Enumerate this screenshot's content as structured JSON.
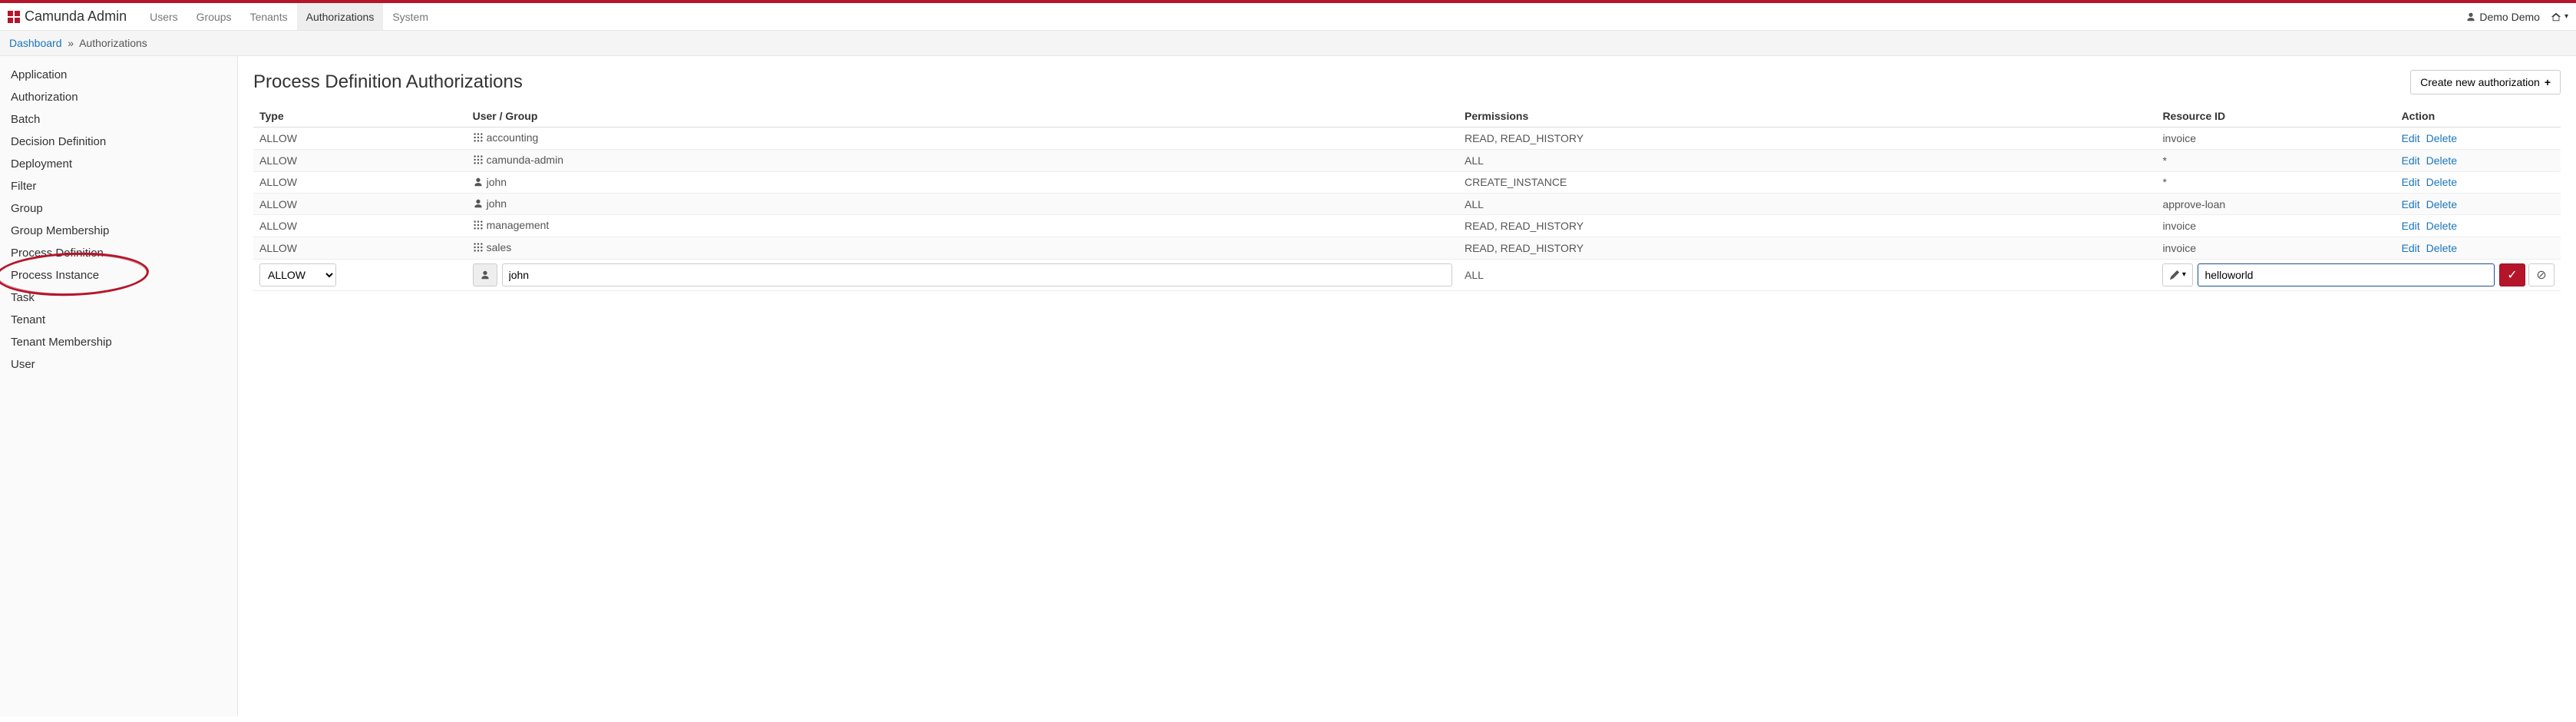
{
  "brand": "Camunda Admin",
  "nav": {
    "items": [
      {
        "label": "Users",
        "active": false
      },
      {
        "label": "Groups",
        "active": false
      },
      {
        "label": "Tenants",
        "active": false
      },
      {
        "label": "Authorizations",
        "active": true
      },
      {
        "label": "System",
        "active": false
      }
    ]
  },
  "user": {
    "name": "Demo Demo"
  },
  "breadcrumb": {
    "root": "Dashboard",
    "sep": "»",
    "current": "Authorizations"
  },
  "sidebar": {
    "items": [
      {
        "label": "Application"
      },
      {
        "label": "Authorization"
      },
      {
        "label": "Batch"
      },
      {
        "label": "Decision Definition"
      },
      {
        "label": "Deployment"
      },
      {
        "label": "Filter"
      },
      {
        "label": "Group"
      },
      {
        "label": "Group Membership"
      },
      {
        "label": "Process Definition"
      },
      {
        "label": "Process Instance"
      },
      {
        "label": "Task"
      },
      {
        "label": "Tenant"
      },
      {
        "label": "Tenant Membership"
      },
      {
        "label": "User"
      }
    ],
    "active_index": 8
  },
  "main": {
    "title": "Process Definition Authorizations",
    "create_button": "Create new authorization"
  },
  "table": {
    "headers": {
      "type": "Type",
      "usergroup": "User / Group",
      "permissions": "Permissions",
      "resid": "Resource ID",
      "action": "Action"
    },
    "rows": [
      {
        "type": "ALLOW",
        "ugType": "group",
        "ug": "accounting",
        "perm": "READ, READ_HISTORY",
        "resid": "invoice"
      },
      {
        "type": "ALLOW",
        "ugType": "group",
        "ug": "camunda-admin",
        "perm": "ALL",
        "resid": "*"
      },
      {
        "type": "ALLOW",
        "ugType": "user",
        "ug": "john",
        "perm": "CREATE_INSTANCE",
        "resid": "*"
      },
      {
        "type": "ALLOW",
        "ugType": "user",
        "ug": "john",
        "perm": "ALL",
        "resid": "approve-loan"
      },
      {
        "type": "ALLOW",
        "ugType": "group",
        "ug": "management",
        "perm": "READ, READ_HISTORY",
        "resid": "invoice"
      },
      {
        "type": "ALLOW",
        "ugType": "group",
        "ug": "sales",
        "perm": "READ, READ_HISTORY",
        "resid": "invoice"
      }
    ],
    "actions": {
      "edit": "Edit",
      "delete": "Delete"
    }
  },
  "new_row": {
    "type_value": "ALLOW",
    "ug_value": "john",
    "perm_value": "ALL",
    "resid_value": "helloworld"
  }
}
